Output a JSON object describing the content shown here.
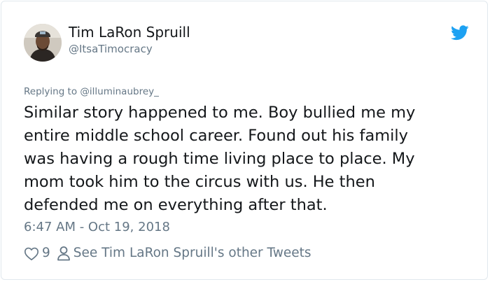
{
  "author": {
    "name": "Tim LaRon Spruill",
    "handle": "@ItsaTimocracy"
  },
  "reply_context": "Replying to @illuminaubrey_",
  "tweet": {
    "lines": [
      "Similar story happened to me. Boy bullied me my",
      "entire middle school career. Found out his family",
      "was having a rough time living place to place. My",
      "mom took him to the circus with us. He then",
      "defended me on everything after that."
    ]
  },
  "timestamp": "6:47 AM - Oct 19, 2018",
  "actions": {
    "like_icon": "heart-icon",
    "like_count": "9",
    "profile_icon": "person-icon",
    "profile_link": "See Tim LaRon Spruill's other Tweets"
  },
  "colors": {
    "brand": "#1da1f2",
    "text": "#14171a",
    "muted": "#657786",
    "border": "#e1e8ed"
  }
}
